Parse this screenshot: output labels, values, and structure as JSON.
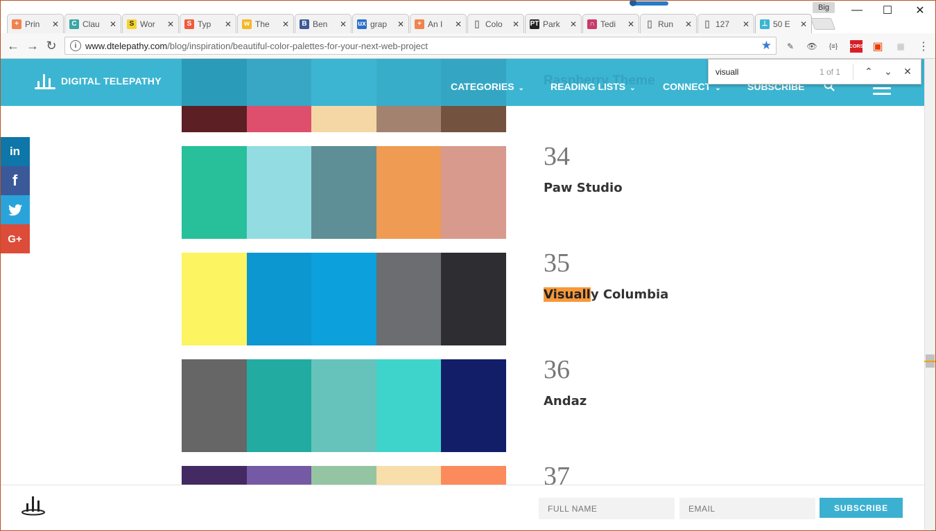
{
  "tabs": [
    {
      "title": "Prin",
      "icon": "plus-square-icon",
      "color": "#f0834f"
    },
    {
      "title": "Clau",
      "icon": "c-letter-icon",
      "color": "#3aa6a6"
    },
    {
      "title": "Wor",
      "icon": "s-letter-icon",
      "color": "#f5d42c"
    },
    {
      "title": "Typ",
      "icon": "s-letter-icon",
      "color": "#f05a3c"
    },
    {
      "title": "The",
      "icon": "w-letter-icon",
      "color": "#f3b728"
    },
    {
      "title": "Ben",
      "icon": "font-icon",
      "color": "#3d5a96"
    },
    {
      "title": "grap",
      "icon": "ux-icon",
      "color": "#2a6ec8"
    },
    {
      "title": "An I",
      "icon": "plus-square-icon",
      "color": "#f0834f"
    },
    {
      "title": "Colo",
      "icon": "page-icon",
      "color": "#888888"
    },
    {
      "title": "Park",
      "icon": "pt-icon",
      "color": "#222222"
    },
    {
      "title": "Tedi",
      "icon": "arch-icon",
      "color": "#c83b6c"
    },
    {
      "title": "Run",
      "icon": "page-icon",
      "color": "#888888"
    },
    {
      "title": "127",
      "icon": "page-icon",
      "color": "#888888"
    },
    {
      "title": "50 E",
      "icon": "dt-logo-icon",
      "color": "#3cb5d2"
    }
  ],
  "browser": {
    "profile": "Big",
    "url_host": "www.dtelepathy.com",
    "url_path": "/blog/inspiration/beautiful-color-palettes-for-your-next-web-project",
    "cors_label": "CORS"
  },
  "find": {
    "query": "visuall",
    "count": "1 of 1"
  },
  "site": {
    "brand": "DIGITAL TELEPATHY",
    "nav": [
      "CATEGORIES",
      "READING LISTS",
      "CONNECT",
      "SUBSCRIBE"
    ],
    "ghost_title": "Raspberry Theme"
  },
  "top_palette": {
    "top": [
      "#2a9bb9",
      "#38a7c5",
      "#3cb5d2",
      "#38adc9",
      "#34a6c3"
    ],
    "bottom": [
      "#5b1f24",
      "#dd4f6c",
      "#f5d7a6",
      "#a38370",
      "#73523f"
    ]
  },
  "palettes": [
    {
      "number": "34",
      "name": "Paw Studio",
      "colors": [
        "#27c09a",
        "#93dce2",
        "#5e8f96",
        "#ef9b53",
        "#d99a8e"
      ]
    },
    {
      "number": "35",
      "name_highlight": "Visuall",
      "name_rest": "y Columbia",
      "colors": [
        "#fdf461",
        "#0c97d1",
        "#0ca0dc",
        "#6c6d71",
        "#2e2e32"
      ]
    },
    {
      "number": "36",
      "name": "Andaz",
      "colors": [
        "#666666",
        "#22aba1",
        "#66c3bb",
        "#3fd4cb",
        "#121e68"
      ]
    },
    {
      "number": "37",
      "colors": [
        "#432a63",
        "#7459a4",
        "#95c4a3",
        "#f7deaa",
        "#fb8a5d"
      ]
    }
  ],
  "social": [
    {
      "label": "in",
      "color": "#0e76a8"
    },
    {
      "label": "f",
      "color": "#3b5998"
    },
    {
      "label": "t",
      "color": "#2aa3db"
    },
    {
      "label": "G+",
      "color": "#dd4b39"
    }
  ],
  "footer": {
    "name_placeholder": "FULL NAME",
    "email_placeholder": "EMAIL",
    "subscribe": "SUBSCRIBE"
  }
}
